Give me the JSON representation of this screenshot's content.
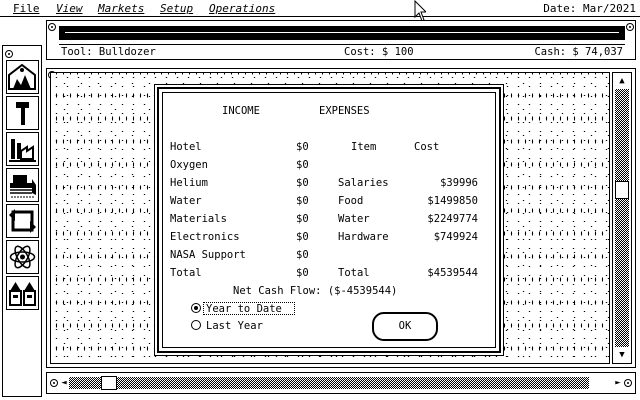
{
  "menubar": {
    "items": [
      "File",
      "View",
      "Markets",
      "Setup",
      "Operations"
    ],
    "date": "Date: Mar/2021"
  },
  "status": {
    "tool": "Tool: Bulldozer",
    "cost": "Cost: $ 100",
    "cash": "Cash: $ 74,037"
  },
  "toolbox": {
    "tools": [
      "habitat-tool",
      "hammer-tool",
      "factory-tool",
      "bulldozer-tool",
      "recycle-tool",
      "atom-tool",
      "storage-tool"
    ]
  },
  "dialog": {
    "income_header": "INCOME",
    "expenses_header": "EXPENSES",
    "item_header": "Item",
    "cost_header": "Cost",
    "income": [
      {
        "label": "Hotel",
        "value": "$0"
      },
      {
        "label": "Oxygen",
        "value": "$0"
      },
      {
        "label": "Helium",
        "value": "$0"
      },
      {
        "label": "Water",
        "value": "$0"
      },
      {
        "label": "Materials",
        "value": "$0"
      },
      {
        "label": "Electronics",
        "value": "$0"
      },
      {
        "label": "NASA Support",
        "value": "$0"
      },
      {
        "label": "Total",
        "value": "$0"
      }
    ],
    "expenses": [
      {
        "label": "Salaries",
        "value": "$39996"
      },
      {
        "label": "Food",
        "value": "$1499850"
      },
      {
        "label": "Water",
        "value": "$2249774"
      },
      {
        "label": "Hardware",
        "value": "$749924"
      },
      {
        "label": "Total",
        "value": "$4539544"
      }
    ],
    "net_cash_flow": "Net Cash Flow: ($-4539544)",
    "radio_ytd": "Year to Date",
    "radio_last_year": "Last Year",
    "ok": "OK"
  },
  "scroll": {
    "up": "▲",
    "down": "▼",
    "left": "◄",
    "right": "►"
  }
}
